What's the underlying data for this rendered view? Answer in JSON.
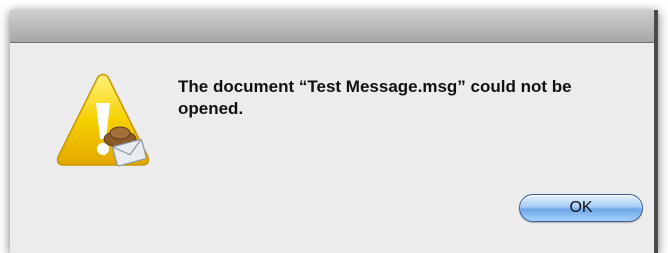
{
  "dialog": {
    "message": "The document “Test Message.msg” could not be opened.",
    "ok_label": "OK",
    "icon": "caution-icon",
    "badge_icon": "envelope-icon"
  },
  "colors": {
    "dialog_background": "#ececec",
    "warning_yellow": "#f6c400",
    "button_accent": "#6ea7e8"
  }
}
